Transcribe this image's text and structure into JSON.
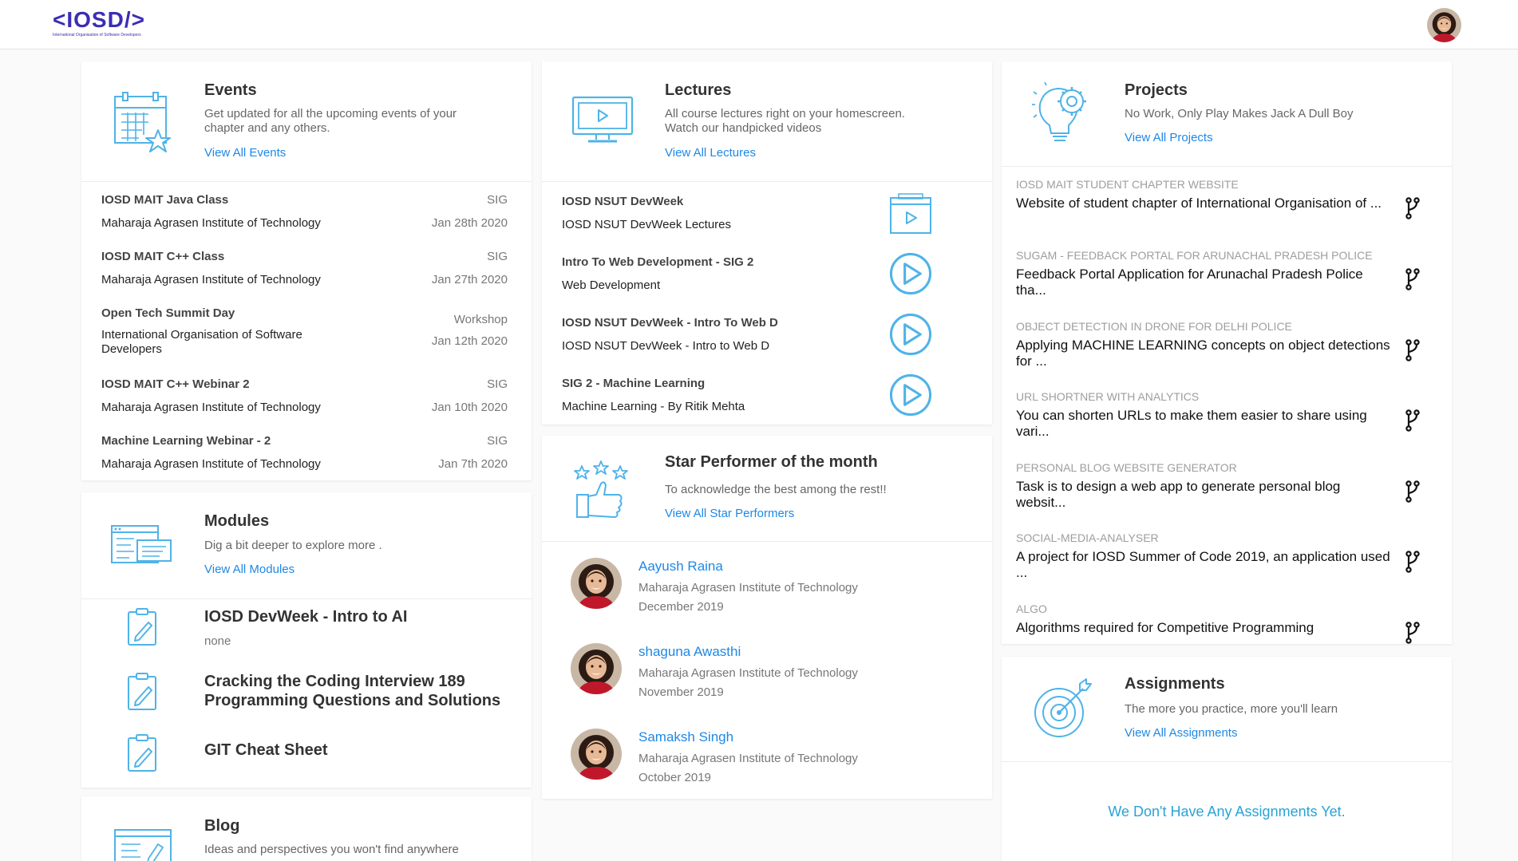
{
  "brand": {
    "logo_text": "IOSD",
    "logo_tagline": "International Organisation of Software Developers"
  },
  "colors": {
    "accent": "#1e88e5",
    "icon_blue": "#4fb3e8",
    "logo": "#3b2db5"
  },
  "events": {
    "title": "Events",
    "desc": "Get updated for all the upcoming events of your chapter and any others.",
    "link": "View All Events",
    "items": [
      {
        "title": "IOSD MAIT Java Class",
        "tag": "SIG",
        "inst": "Maharaja Agrasen Institute of Technology",
        "date": "Jan 28th 2020"
      },
      {
        "title": "IOSD MAIT C++ Class",
        "tag": "SIG",
        "inst": "Maharaja Agrasen Institute of Technology",
        "date": "Jan 27th 2020"
      },
      {
        "title": "Open Tech Summit Day",
        "tag": "Workshop",
        "inst": "International Organisation of Software Developers",
        "date": "Jan 12th 2020"
      },
      {
        "title": "IOSD MAIT C++ Webinar 2",
        "tag": "SIG",
        "inst": "Maharaja Agrasen Institute of Technology",
        "date": "Jan 10th 2020"
      },
      {
        "title": "Machine Learning Webinar - 2",
        "tag": "SIG",
        "inst": "Maharaja Agrasen Institute of Technology",
        "date": "Jan 7th 2020"
      }
    ]
  },
  "modules": {
    "title": "Modules",
    "desc": "Dig a bit deeper to explore more .",
    "link": "View All Modules",
    "items": [
      {
        "title": "IOSD DevWeek - Intro to AI",
        "sub": "none"
      },
      {
        "title": "Cracking the Coding Interview 189 Programming Questions and Solutions",
        "sub": ""
      },
      {
        "title": "GIT Cheat Sheet",
        "sub": ""
      }
    ]
  },
  "blog": {
    "title": "Blog",
    "desc": "Ideas and perspectives you won't find anywhere"
  },
  "lectures": {
    "title": "Lectures",
    "desc": "All course lectures right on your homescreen. Watch our handpicked videos",
    "link": "View All Lectures",
    "items": [
      {
        "title": "IOSD NSUT DevWeek",
        "sub": "IOSD NSUT DevWeek Lectures",
        "icon": "video-window-icon"
      },
      {
        "title": "Intro To Web Development - SIG 2",
        "sub": "Web Development",
        "icon": "play-circle-icon"
      },
      {
        "title": "IOSD NSUT DevWeek - Intro To Web D",
        "sub": "IOSD NSUT DevWeek - Intro to Web D",
        "icon": "play-circle-icon"
      },
      {
        "title": "SIG 2 - Machine Learning",
        "sub": "Machine Learning - By Ritik Mehta",
        "icon": "play-circle-icon"
      }
    ]
  },
  "stars": {
    "title": "Star Performer of the month",
    "desc": "To acknowledge the best among the rest!!",
    "link": "View All Star Performers",
    "items": [
      {
        "name": "Aayush Raina",
        "inst": "Maharaja Agrasen Institute of Technology",
        "month": "December 2019"
      },
      {
        "name": "shaguna Awasthi",
        "inst": "Maharaja Agrasen Institute of Technology",
        "month": "November 2019"
      },
      {
        "name": "Samaksh Singh",
        "inst": "Maharaja Agrasen Institute of Technology",
        "month": "October 2019"
      }
    ]
  },
  "projects": {
    "title": "Projects",
    "desc": "No Work, Only Play Makes Jack A Dull Boy",
    "link": "View All Projects",
    "items": [
      {
        "cat": "IOSD MAIT STUDENT CHAPTER WEBSITE",
        "desc": "Website of student chapter of International Organisation of ..."
      },
      {
        "cat": "SUGAM - FEEDBACK PORTAL FOR ARUNACHAL PRADESH POLICE",
        "desc": "Feedback Portal Application for Arunachal Pradesh Police tha..."
      },
      {
        "cat": "OBJECT DETECTION IN DRONE FOR DELHI POLICE",
        "desc": "Applying MACHINE LEARNING concepts on object detections for ..."
      },
      {
        "cat": "URL SHORTNER WITH ANALYTICS",
        "desc": "You can shorten URLs to make them easier to share using vari..."
      },
      {
        "cat": "PERSONAL BLOG WEBSITE GENERATOR",
        "desc": "Task is to design a web app to generate personal blog websit..."
      },
      {
        "cat": "SOCIAL-MEDIA-ANALYSER",
        "desc": "A project for IOSD Summer of Code 2019, an application used ..."
      },
      {
        "cat": "ALGO",
        "desc": "Algorithms required for Competitive Programming"
      }
    ]
  },
  "assignments": {
    "title": "Assignments",
    "desc": "The more you practice, more you'll learn",
    "link": "View All Assignments",
    "empty": "We Don't Have Any Assignments Yet."
  }
}
